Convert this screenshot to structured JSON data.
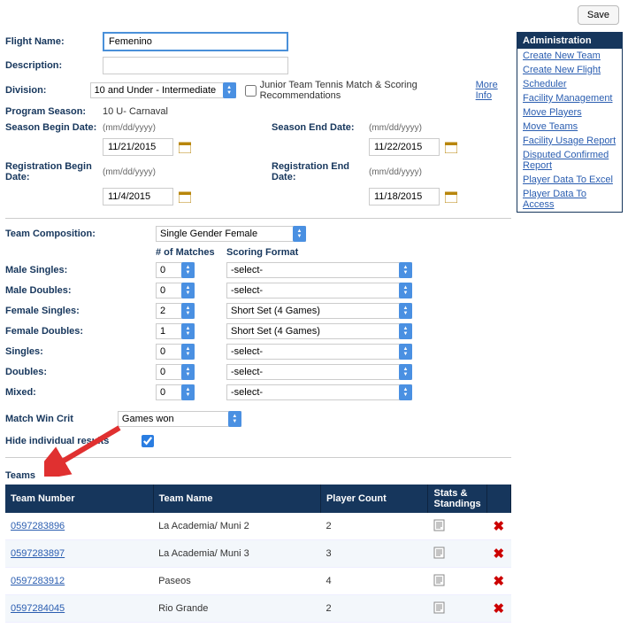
{
  "buttons": {
    "save": "Save"
  },
  "labels": {
    "flightName": "Flight Name:",
    "description": "Description:",
    "division": "Division:",
    "programSeason": "Program Season:",
    "seasonBegin": "Season Begin Date:",
    "seasonEnd": "Season End Date:",
    "regBegin": "Registration Begin Date:",
    "regEnd": "Registration End Date:",
    "dateHint": "(mm/dd/yyyy)",
    "jtt": "Junior Team Tennis Match & Scoring Recommendations",
    "moreInfo": "More Info",
    "teamComp": "Team Composition:",
    "numMatches": "# of Matches",
    "scoringFormat": "Scoring Format",
    "maleSingles": "Male Singles:",
    "maleDoubles": "Male Doubles:",
    "femaleSingles": "Female Singles:",
    "femaleDoubles": "Female Doubles:",
    "singles": "Singles:",
    "doubles": "Doubles:",
    "mixed": "Mixed:",
    "matchWin": "Match Win Crit",
    "hideInd": "Hide individual results",
    "teams": "Teams"
  },
  "fields": {
    "flightName": "Femenino",
    "description": "",
    "division": "10 and Under - Intermediate",
    "programSeason": "10 U- Carnaval",
    "seasonBegin": "11/21/2015",
    "seasonEnd": "11/22/2015",
    "regBegin": "11/4/2015",
    "regEnd": "11/18/2015",
    "teamComp": "Single Gender Female",
    "matchWin": "Games won",
    "hide": true
  },
  "lineup": {
    "maleSingles": {
      "n": "0",
      "fmt": "-select-"
    },
    "maleDoubles": {
      "n": "0",
      "fmt": "-select-"
    },
    "femaleSingles": {
      "n": "2",
      "fmt": "Short Set (4 Games)"
    },
    "femaleDoubles": {
      "n": "1",
      "fmt": "Short Set (4 Games)"
    },
    "singles": {
      "n": "0",
      "fmt": "-select-"
    },
    "doubles": {
      "n": "0",
      "fmt": "-select-"
    },
    "mixed": {
      "n": "0",
      "fmt": "-select-"
    }
  },
  "admin": {
    "header": "Administration",
    "links": [
      "Create New Team",
      "Create New Flight",
      "Scheduler",
      "Facility Management",
      "Move Players",
      "Move Teams",
      "Facility Usage Report",
      "Disputed Confirmed Report",
      "Player Data To Excel",
      "Player Data To Access"
    ]
  },
  "teamsTable": {
    "cols": {
      "c1": "Team Number",
      "c2": "Team Name",
      "c3": "Player Count",
      "c4": "Stats & Standings"
    },
    "rows": [
      {
        "num": "0597283896",
        "name": "La Academia/ Muni 2",
        "count": "2"
      },
      {
        "num": "0597283897",
        "name": "La Academia/ Muni 3",
        "count": "3"
      },
      {
        "num": "0597283912",
        "name": "Paseos",
        "count": "4"
      },
      {
        "num": "0597284045",
        "name": "Rio Grande",
        "count": "2"
      }
    ]
  }
}
